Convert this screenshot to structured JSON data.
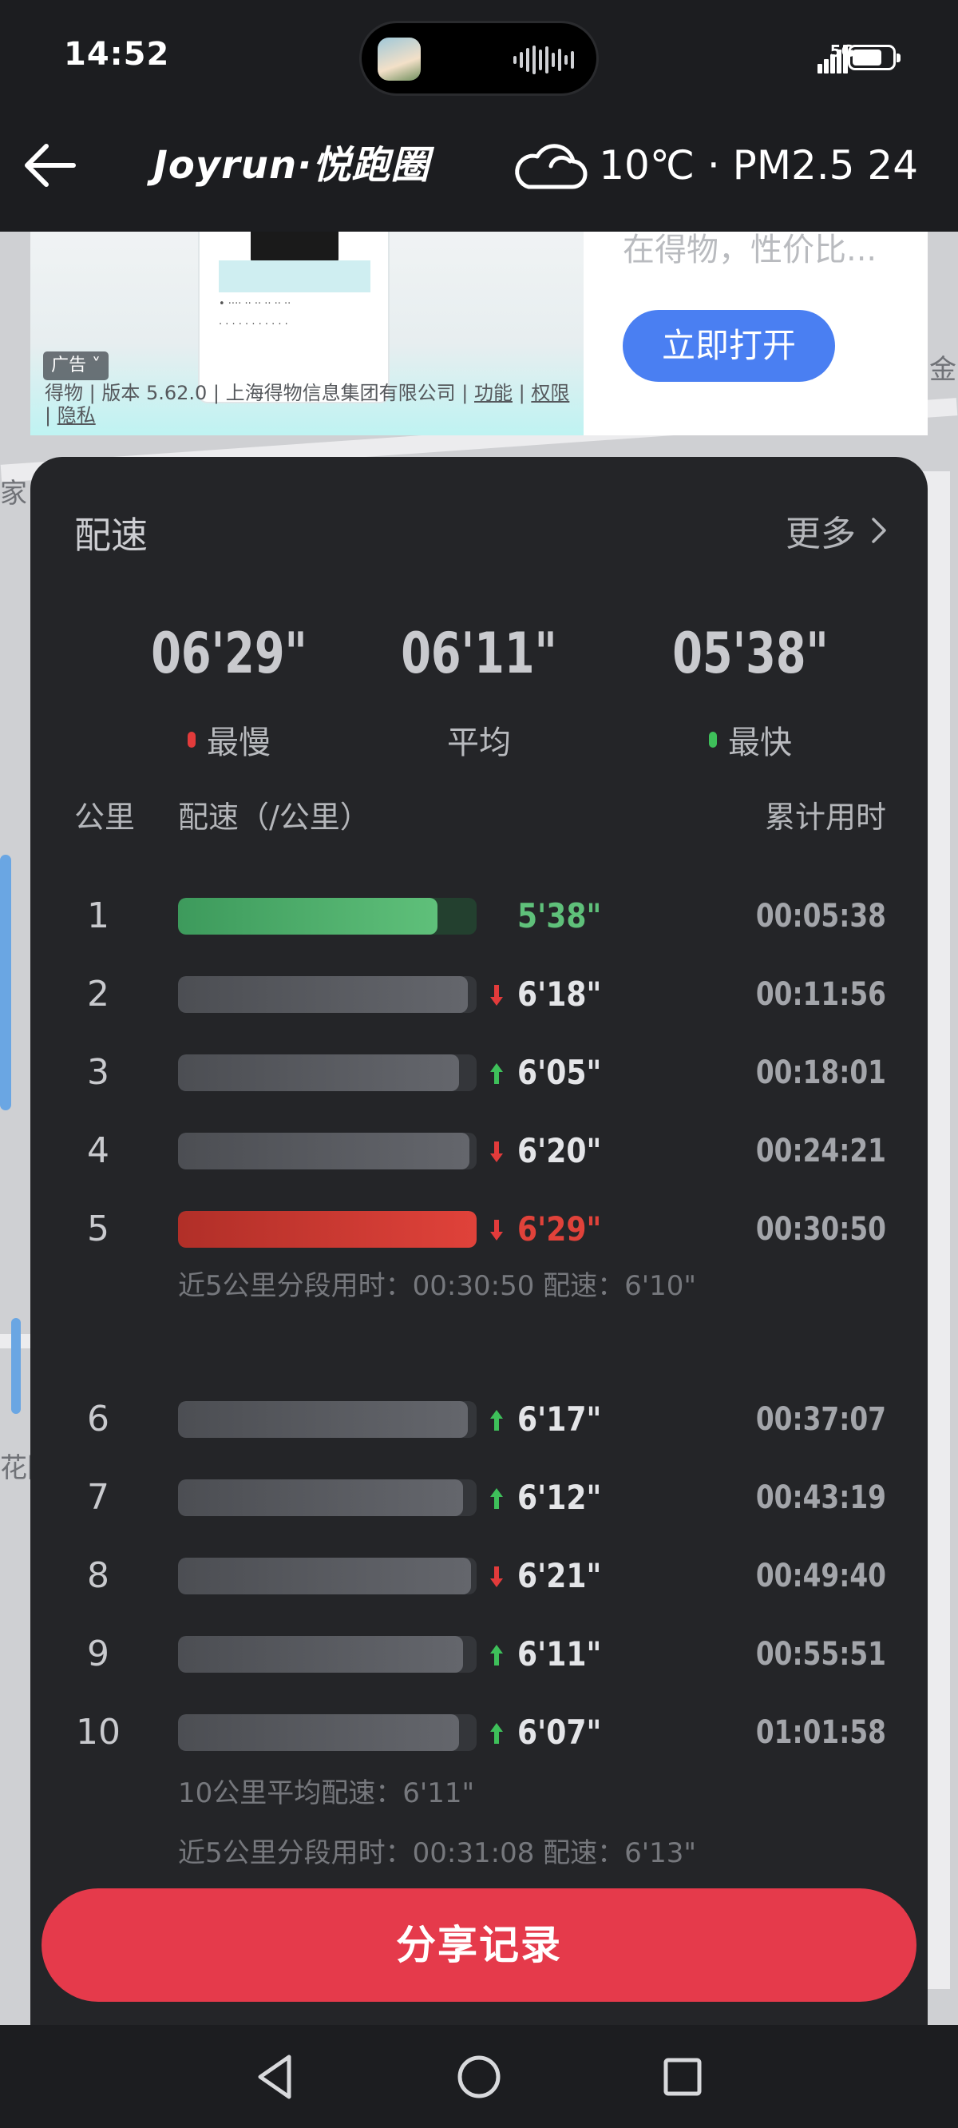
{
  "status_bar": {
    "time": "14:52",
    "network": "5G"
  },
  "header": {
    "logo": "Joyrun·悦跑圈",
    "weather_icon": "cloud-icon",
    "weather_text": "10℃ · PM2.5 24"
  },
  "ad": {
    "tag": "广告",
    "disclaimer_prefix": "得物 | 版本 5.62.0 | 上海得物信息集团有限公司 | ",
    "link_features": "功能",
    "link_permissions": "权限",
    "link_privacy": "隐私",
    "copy_partial": "在得物，性价比...",
    "open_button": "立即打开"
  },
  "map": {
    "label_left_1": "家",
    "label_left_2": "花园",
    "label_right": "金"
  },
  "pace_card": {
    "title": "配速",
    "more": "更多",
    "summary": [
      {
        "value": "06'29\"",
        "label": "最慢",
        "dot_color": "#e23b3b"
      },
      {
        "value": "06'11\"",
        "label": "平均",
        "dot_color": ""
      },
      {
        "value": "05'38\"",
        "label": "最快",
        "dot_color": "#3ec05a"
      }
    ],
    "headers": {
      "km": "公里",
      "pace": "配速（/公里）",
      "cumulative": "累计用时"
    },
    "rows": [
      {
        "km": "1",
        "pace": "5'38\"",
        "trend": "fastest",
        "cumulative": "00:05:38",
        "bar_fraction": 0.87
      },
      {
        "km": "2",
        "pace": "6'18\"",
        "trend": "down",
        "cumulative": "00:11:56",
        "bar_fraction": 0.97
      },
      {
        "km": "3",
        "pace": "6'05\"",
        "trend": "up",
        "cumulative": "00:18:01",
        "bar_fraction": 0.94
      },
      {
        "km": "4",
        "pace": "6'20\"",
        "trend": "down",
        "cumulative": "00:24:21",
        "bar_fraction": 0.975
      },
      {
        "km": "5",
        "pace": "6'29\"",
        "trend": "slowest",
        "cumulative": "00:30:50",
        "bar_fraction": 1.0
      },
      {
        "km": "6",
        "pace": "6'17\"",
        "trend": "up",
        "cumulative": "00:37:07",
        "bar_fraction": 0.97
      },
      {
        "km": "7",
        "pace": "6'12\"",
        "trend": "up",
        "cumulative": "00:43:19",
        "bar_fraction": 0.955
      },
      {
        "km": "8",
        "pace": "6'21\"",
        "trend": "down",
        "cumulative": "00:49:40",
        "bar_fraction": 0.98
      },
      {
        "km": "9",
        "pace": "6'11\"",
        "trend": "up",
        "cumulative": "00:55:51",
        "bar_fraction": 0.955
      },
      {
        "km": "10",
        "pace": "6'07\"",
        "trend": "up",
        "cumulative": "01:01:58",
        "bar_fraction": 0.94
      }
    ],
    "segment_note_1": "近5公里分段用时：00:30:50   配速：6'10\"",
    "avg_note_10k": "10公里平均配速：6'11\"",
    "segment_note_2": "近5公里分段用时：00:31:08   配速：6'13\""
  },
  "share_button": "分享记录",
  "colors": {
    "fast": "#5fc07a",
    "slow": "#e0423a",
    "up_arrow": "#3ec05a",
    "down_arrow": "#e23b3b",
    "share": "#e53a4b",
    "ad_button": "#4a7ff2"
  }
}
